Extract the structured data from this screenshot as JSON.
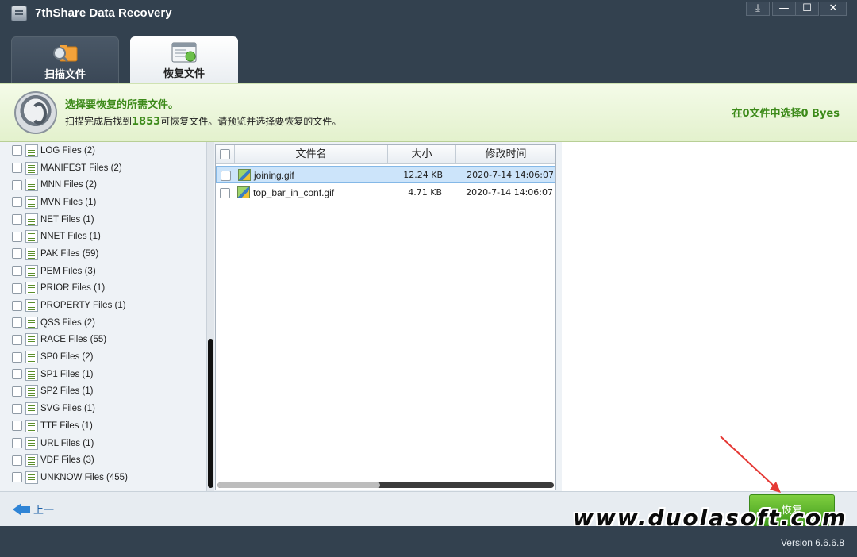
{
  "window": {
    "title": "7thShare Data Recovery",
    "controls": {
      "download": "⤓",
      "minimize": "—",
      "maximize": "☐",
      "close": "✕"
    }
  },
  "tabs": [
    {
      "label": "扫描文件",
      "icon": "scan-folder-icon",
      "active": false
    },
    {
      "label": "恢复文件",
      "icon": "recover-files-icon",
      "active": true
    }
  ],
  "banner": {
    "title": "选择要恢复的所需文件。",
    "sub_prefix": "扫描完成后找到",
    "found_count": "1853",
    "sub_suffix": "可恢复文件。请预览并选择要恢复的文件。",
    "selection_summary": "在0文件中选择0 Byes"
  },
  "file_types": [
    "LOG Files (2)",
    "MANIFEST Files (2)",
    "MNN Files (2)",
    "MVN Files (1)",
    "NET Files (1)",
    "NNET Files (1)",
    "PAK Files (59)",
    "PEM Files (3)",
    "PRIOR Files (1)",
    "PROPERTY Files (1)",
    "QSS Files (2)",
    "RACE Files (55)",
    "SP0 Files (2)",
    "SP1 Files (1)",
    "SP2 Files (1)",
    "SVG Files (1)",
    "TTF Files (1)",
    "URL Files (1)",
    "VDF Files (3)",
    "UNKNOW Files (455)"
  ],
  "file_list": {
    "columns": [
      "文件名",
      "大小",
      "修改时间"
    ],
    "rows": [
      {
        "name": "joining.gif",
        "size": "12.24 KB",
        "modified": "2020-7-14 14:06:07",
        "selected": true
      },
      {
        "name": "top_bar_in_conf.gif",
        "size": "4.71 KB",
        "modified": "2020-7-14 14:06:07",
        "selected": false
      }
    ]
  },
  "footer": {
    "back_label": "上一",
    "recover_label": "恢复",
    "watermark": "www.duolasoft.com",
    "version": "Version 6.6.6.8"
  },
  "colors": {
    "accent_green": "#3c8a19",
    "title_bar": "#33414f",
    "selection": "#cce4fa",
    "annotation_red": "#e53935"
  }
}
